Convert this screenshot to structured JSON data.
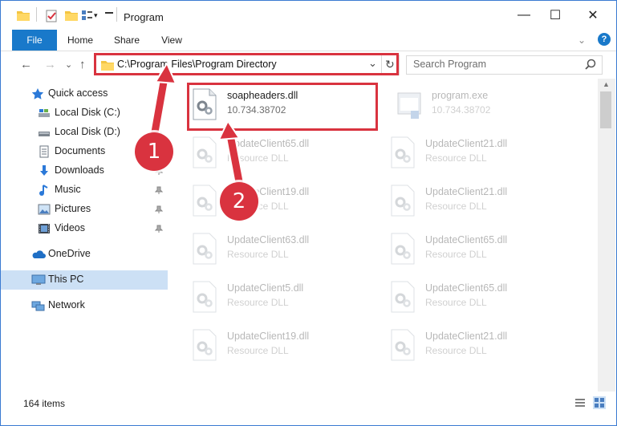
{
  "window": {
    "title": "Program",
    "controls": {
      "minimize": "—",
      "maximize": "☐",
      "close": "✕"
    }
  },
  "ribbon": {
    "tabs": [
      {
        "label": "File"
      },
      {
        "label": "Home"
      },
      {
        "label": "Share"
      },
      {
        "label": "View"
      }
    ],
    "help_label": "?",
    "expand_label": "⌄"
  },
  "address": {
    "path": "C:\\Program Files\\Program Directory",
    "dropdown": "⌄",
    "refresh": "↻"
  },
  "search": {
    "placeholder": "Search Program",
    "icon": "search-icon"
  },
  "nav": {
    "back": "←",
    "forward": "→",
    "recent": "⌄",
    "up": "↑"
  },
  "sidebar": {
    "items": [
      {
        "label": "Quick access",
        "icon": "star-icon"
      },
      {
        "label": "Local Disk (C:)",
        "icon": "drive-icon"
      },
      {
        "label": "Local Disk (D:)",
        "icon": "drive-icon"
      },
      {
        "label": "Documents",
        "icon": "documents-icon"
      },
      {
        "label": "Downloads",
        "icon": "download-icon"
      },
      {
        "label": "Music",
        "icon": "music-icon"
      },
      {
        "label": "Pictures",
        "icon": "pictures-icon"
      },
      {
        "label": "Videos",
        "icon": "videos-icon"
      },
      {
        "label": "OneDrive",
        "icon": "cloud-icon"
      },
      {
        "label": "This PC",
        "icon": "computer-icon"
      },
      {
        "label": "Network",
        "icon": "network-icon"
      }
    ]
  },
  "files": {
    "items": [
      {
        "name": "soapheaders.dll",
        "detail": "10.734.38702"
      },
      {
        "name": "program.exe",
        "detail": "10.734.38702"
      },
      {
        "name": "UpdateClient65.dll",
        "detail": "Resource DLL"
      },
      {
        "name": "UpdateClient21.dll",
        "detail": "Resource DLL"
      },
      {
        "name": "UpdateClient19.dll",
        "detail": "Resource DLL"
      },
      {
        "name": "UpdateClient21.dll",
        "detail": "Resource DLL"
      },
      {
        "name": "UpdateClient63.dll",
        "detail": "Resource DLL"
      },
      {
        "name": "UpdateClient65.dll",
        "detail": "Resource DLL"
      },
      {
        "name": "UpdateClient5.dll",
        "detail": "Resource DLL"
      },
      {
        "name": "UpdateClient65.dll",
        "detail": "Resource DLL"
      },
      {
        "name": "UpdateClient19.dll",
        "detail": "Resource DLL"
      },
      {
        "name": "UpdateClient21.dll",
        "detail": "Resource DLL"
      }
    ]
  },
  "status": {
    "item_count": "164 items"
  },
  "annotations": {
    "step1": "1",
    "step2": "2"
  },
  "colors": {
    "accent": "#1979ca",
    "highlight": "#d9333f",
    "selected": "#cce0f5"
  }
}
